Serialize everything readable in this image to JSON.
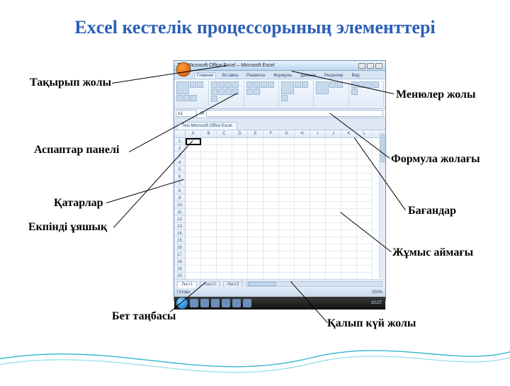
{
  "title": "Excel кестелік процессорының элементтері",
  "labels": {
    "title_row": "Тақырып жолы",
    "toolbar": "Аспаптар панелі",
    "rows": "Қатарлар",
    "active_cell": "Екпінді ұяшық",
    "sheet_tab": "Бет таңбасы",
    "menu_row": "Менюлер жолы",
    "formula_bar": "Формула жолағы",
    "columns": "Бағандар",
    "work_area": "Жұмыс аймағы",
    "status_bar": "Қалып күй жолы"
  },
  "excel": {
    "window_title": "Test Microsoft Office Excel – Microsoft Excel",
    "ribbon_tabs": [
      "Главная",
      "Вставка",
      "Разметка",
      "Формулы",
      "Данные",
      "Рецензир",
      "Вид"
    ],
    "doc_tab": "Test Microsoft Office Excel",
    "name_box": "A1",
    "columns": [
      "A",
      "B",
      "C",
      "D",
      "E",
      "F",
      "G",
      "H",
      "I",
      "J",
      "K",
      "L"
    ],
    "rows": [
      "1",
      "2",
      "3",
      "4",
      "5",
      "6",
      "7",
      "8",
      "9",
      "10",
      "11",
      "12",
      "13",
      "14",
      "15",
      "16",
      "17",
      "18",
      "19",
      "20"
    ],
    "sheet_tabs": [
      "Лист1",
      "Лист2",
      "Лист3"
    ],
    "status_left": "Готово",
    "status_right": "100%",
    "clock": "10:27"
  }
}
